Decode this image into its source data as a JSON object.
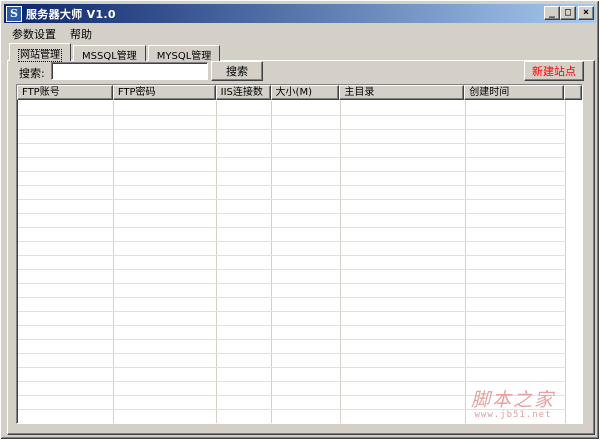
{
  "window": {
    "title": "服务器大师 V1.0",
    "icon_letter": "S",
    "controls": {
      "minimize": "_",
      "maximize": "□",
      "close": "×"
    }
  },
  "menu": {
    "items": [
      "参数设置",
      "帮助"
    ]
  },
  "tabs": [
    {
      "label": "网站管理",
      "active": true
    },
    {
      "label": "MSSQL管理",
      "active": false
    },
    {
      "label": "MYSQL管理",
      "active": false
    }
  ],
  "search": {
    "label": "搜索:",
    "value": "",
    "placeholder": "",
    "button": "搜索"
  },
  "toolbar": {
    "new_site_label": "新建站点",
    "new_site_color": "#ff0000"
  },
  "table": {
    "columns": [
      "FTP账号",
      "FTP密码",
      "IIS连接数",
      "大小(M)",
      "主目录",
      "创建时间"
    ],
    "rows": []
  },
  "watermark": {
    "text": "脚本之家",
    "url": "www.jb51.net"
  }
}
